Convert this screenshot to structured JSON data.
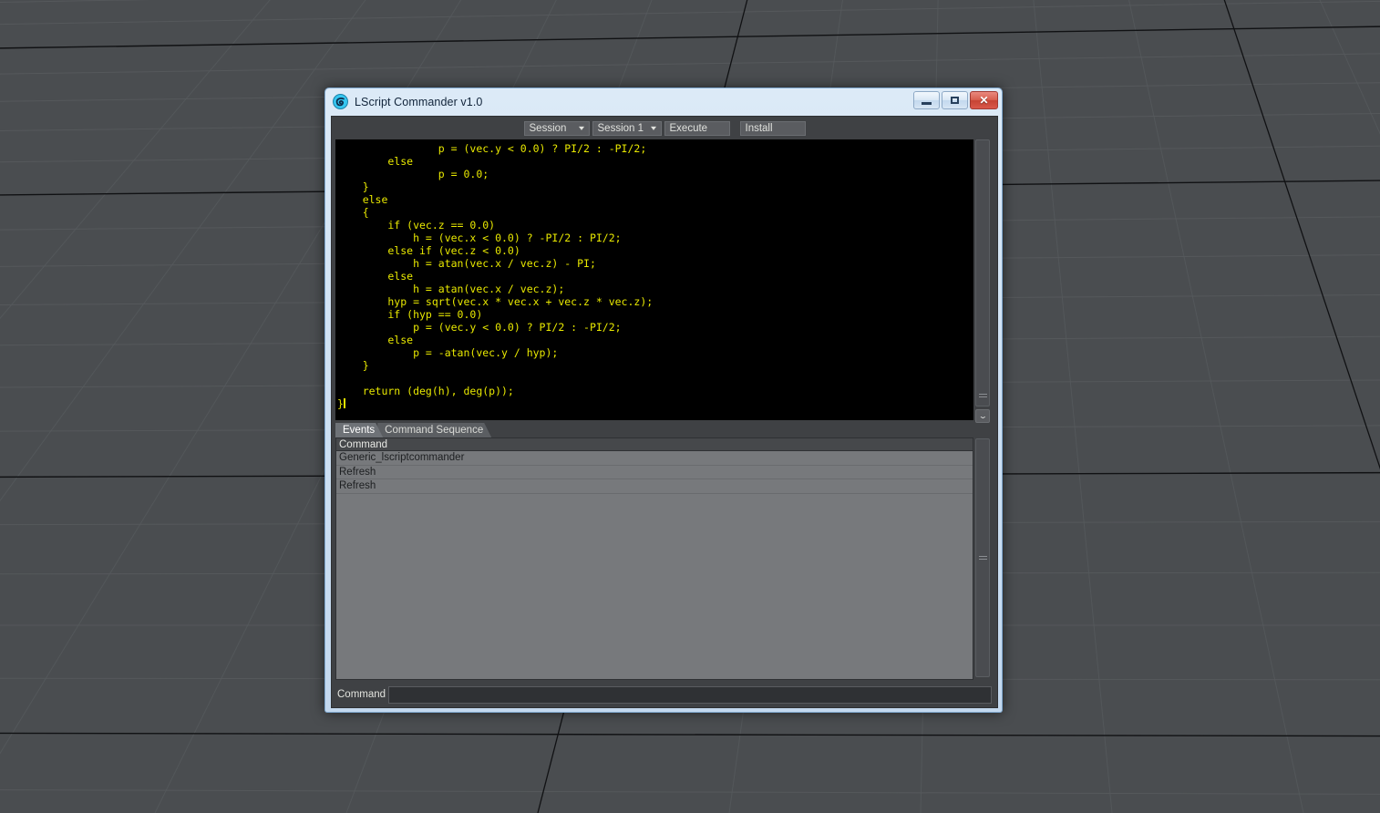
{
  "window": {
    "title": "LScript Commander v1.0",
    "app_icon": "spiral-logo-icon",
    "controls": {
      "minimize": "minimize-icon",
      "restore": "restore-icon",
      "close": "✕"
    }
  },
  "toolbar": {
    "session_label": "Session",
    "session_caret": "▾",
    "session_number_label": "Session 1",
    "session_number_caret": "▾",
    "execute_label": "Execute",
    "install_label": "Install"
  },
  "editor": {
    "language": "LScript",
    "text_color": "#e8e800",
    "background_color": "#000000",
    "caret_visible": true,
    "lines": [
      "                p = (vec.y < 0.0) ? PI/2 : -PI/2;",
      "        else",
      "                p = 0.0;",
      "    }",
      "    else",
      "    {",
      "        if (vec.z == 0.0)",
      "            h = (vec.x < 0.0) ? -PI/2 : PI/2;",
      "        else if (vec.z < 0.0)",
      "            h = atan(vec.x / vec.z) - PI;",
      "        else",
      "            h = atan(vec.x / vec.z);",
      "        hyp = sqrt(vec.x * vec.x + vec.z * vec.z);",
      "        if (hyp == 0.0)",
      "            p = (vec.y < 0.0) ? PI/2 : -PI/2;",
      "        else",
      "            p = -atan(vec.y / hyp);",
      "    }",
      "",
      "    return (deg(h), deg(p));",
      "}"
    ]
  },
  "editor_scroll": {
    "grip_icon": "scroll-grip-icon",
    "down_button_icon": "chevron-down-icon",
    "down_button_glyph": "⌄"
  },
  "tabs": [
    {
      "label": "Events",
      "active": true
    },
    {
      "label": "Command Sequence",
      "active": false
    }
  ],
  "list": {
    "columns": [
      "Command"
    ],
    "rows": [
      {
        "command": "Generic_lscriptcommander"
      },
      {
        "command": "Refresh"
      },
      {
        "command": "Refresh"
      }
    ],
    "scroll": {
      "grip_icon": "scroll-grip-icon"
    }
  },
  "command_bar": {
    "label": "Command",
    "value": "",
    "placeholder": ""
  },
  "viewport": {
    "background_color": "#4a4d50",
    "grid_minor_color": "#5a5d60",
    "grid_major_color": "#111214"
  }
}
